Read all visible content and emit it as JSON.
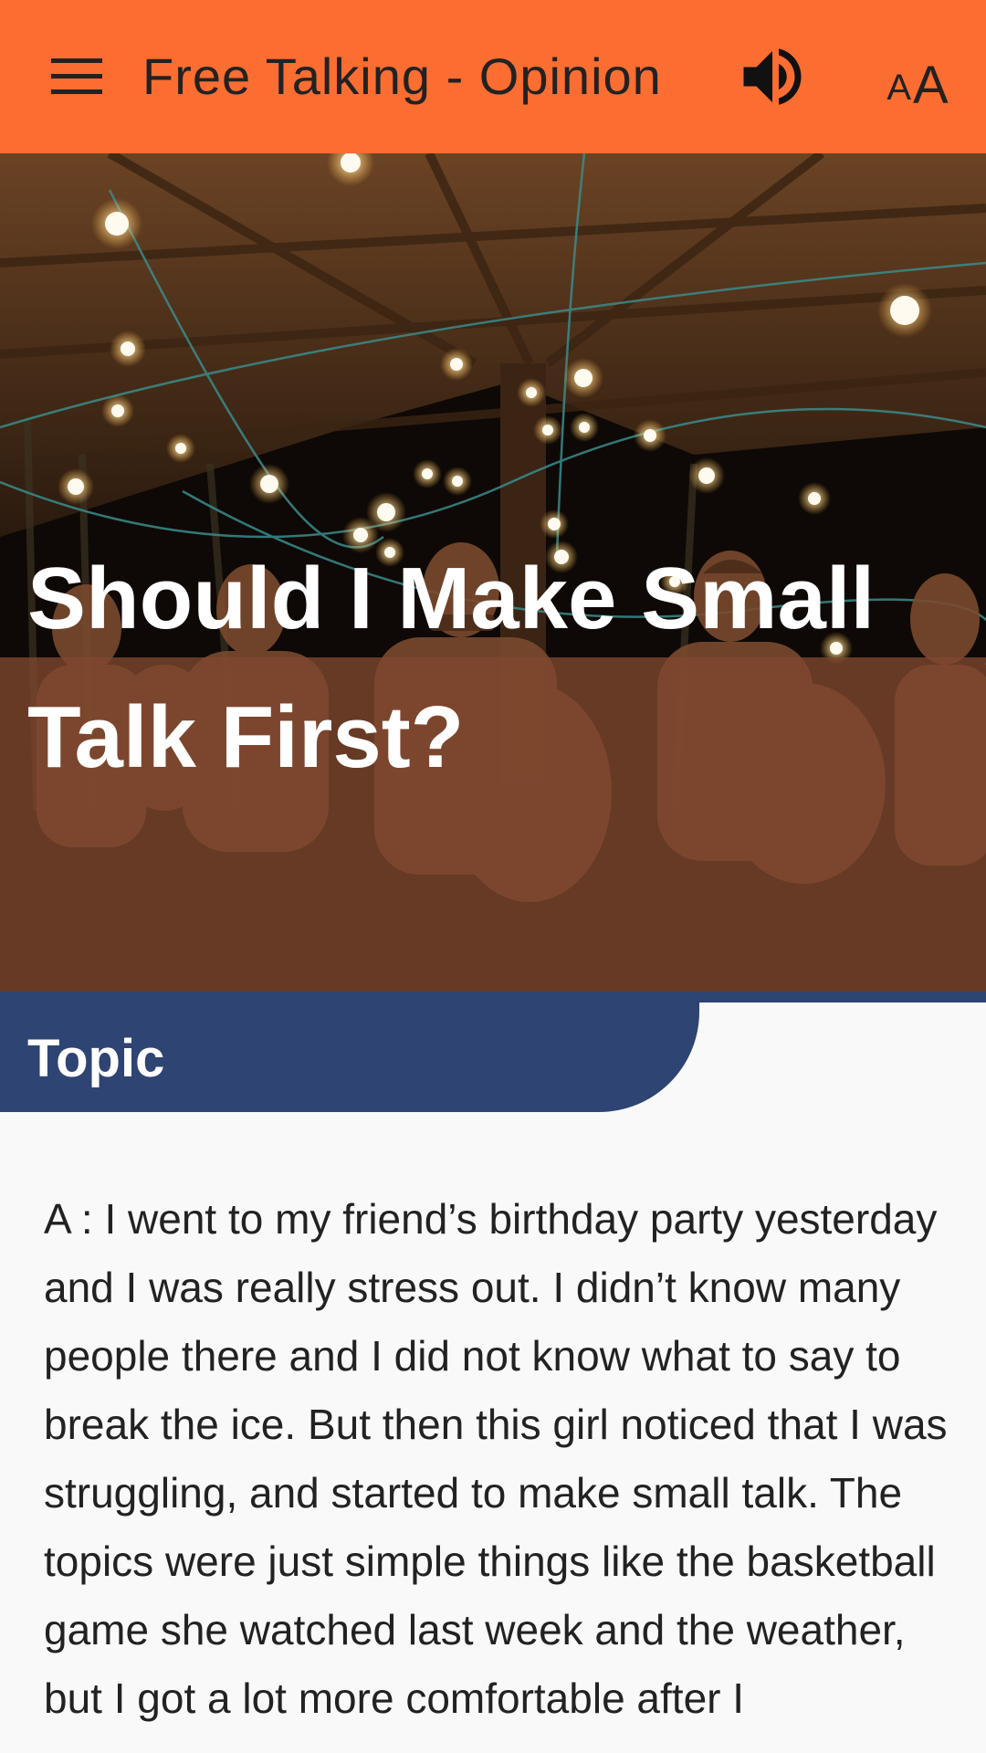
{
  "app_bar": {
    "title": "Free Talking - Opinion",
    "menu_icon": "hamburger-menu-icon",
    "volume_icon": "volume-up-icon",
    "font_size_icon": "font-size-icon",
    "font_size_small": "A",
    "font_size_large": "A",
    "background_color": "#fb6d31"
  },
  "hero": {
    "title": "Should I Make Small Talk First?",
    "image_description": "people sitting under a gazebo with string lights at night",
    "overlay_color": "#804830"
  },
  "topic": {
    "label": "Topic",
    "tab_color": "#2e4472"
  },
  "dialogue": {
    "text": "A : I went to my friend’s birthday party yesterday and I was really stress out. I didn’t know many people there and I did not know what to say to break the ice. But then this girl noticed that I was struggling, and started to make small talk. The topics were just simple things like the basketball game she watched last week and the weather, but I got a lot more comfortable after I"
  }
}
